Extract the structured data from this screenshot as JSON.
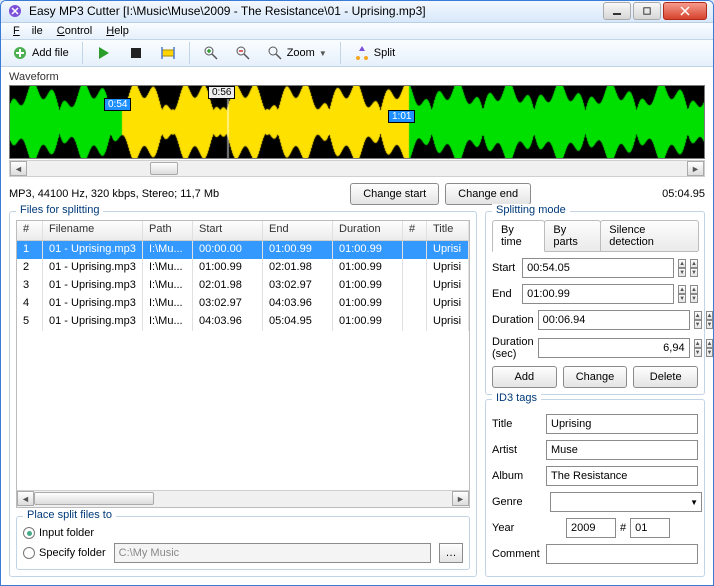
{
  "window": {
    "title": "Easy MP3 Cutter [I:\\Music\\Muse\\2009 - The Resistance\\01 - Uprising.mp3]"
  },
  "menu": {
    "file": "File",
    "control": "Control",
    "help": "Help"
  },
  "toolbar": {
    "addfile": "Add file",
    "zoom": "Zoom",
    "split": "Split"
  },
  "waveform": {
    "label": "Waveform",
    "marker_left": "0:54",
    "marker_center": "0:56",
    "marker_right": "1:01"
  },
  "fileinfo": {
    "text": "MP3, 44100 Hz, 320 kbps, Stereo; 11,7 Mb",
    "totaltime": "05:04.95",
    "change_start": "Change start",
    "change_end": "Change end"
  },
  "files_panel": {
    "title": "Files for splitting",
    "headers": {
      "idx": "#",
      "filename": "Filename",
      "path": "Path",
      "start": "Start",
      "end": "End",
      "duration": "Duration",
      "n": "#",
      "title": "Title"
    },
    "rows": [
      {
        "idx": "1",
        "fn": "01 - Uprising.mp3",
        "path": "I:\\Mu...",
        "start": "00:00.00",
        "end": "01:00.99",
        "dur": "01:00.99",
        "n": "",
        "title": "Uprisi"
      },
      {
        "idx": "2",
        "fn": "01 - Uprising.mp3",
        "path": "I:\\Mu...",
        "start": "01:00.99",
        "end": "02:01.98",
        "dur": "01:00.99",
        "n": "",
        "title": "Uprisi"
      },
      {
        "idx": "3",
        "fn": "01 - Uprising.mp3",
        "path": "I:\\Mu...",
        "start": "02:01.98",
        "end": "03:02.97",
        "dur": "01:00.99",
        "n": "",
        "title": "Uprisi"
      },
      {
        "idx": "4",
        "fn": "01 - Uprising.mp3",
        "path": "I:\\Mu...",
        "start": "03:02.97",
        "end": "04:03.96",
        "dur": "01:00.99",
        "n": "",
        "title": "Uprisi"
      },
      {
        "idx": "5",
        "fn": "01 - Uprising.mp3",
        "path": "I:\\Mu...",
        "start": "04:03.96",
        "end": "05:04.95",
        "dur": "01:00.99",
        "n": "",
        "title": "Uprisi"
      }
    ]
  },
  "splitting": {
    "title": "Splitting mode",
    "tabs": {
      "bytime": "By time",
      "byparts": "By parts",
      "silence": "Silence detection"
    },
    "labels": {
      "start": "Start",
      "end": "End",
      "duration": "Duration",
      "duration_sec": "Duration (sec)"
    },
    "values": {
      "start": "00:54.05",
      "end": "01:00.99",
      "duration": "00:06.94",
      "duration_sec": "6,94"
    },
    "buttons": {
      "add": "Add",
      "change": "Change",
      "delete": "Delete"
    }
  },
  "id3": {
    "title_label": "ID3 tags",
    "labels": {
      "title": "Title",
      "artist": "Artist",
      "album": "Album",
      "genre": "Genre",
      "year": "Year",
      "track": "#",
      "comment": "Comment"
    },
    "values": {
      "title": "Uprising",
      "artist": "Muse",
      "album": "The Resistance",
      "genre": "",
      "year": "2009",
      "track": "01",
      "comment": ""
    }
  },
  "place": {
    "title": "Place split files to",
    "input_folder": "Input folder",
    "specify_folder": "Specify folder",
    "path": "C:\\My Music"
  }
}
